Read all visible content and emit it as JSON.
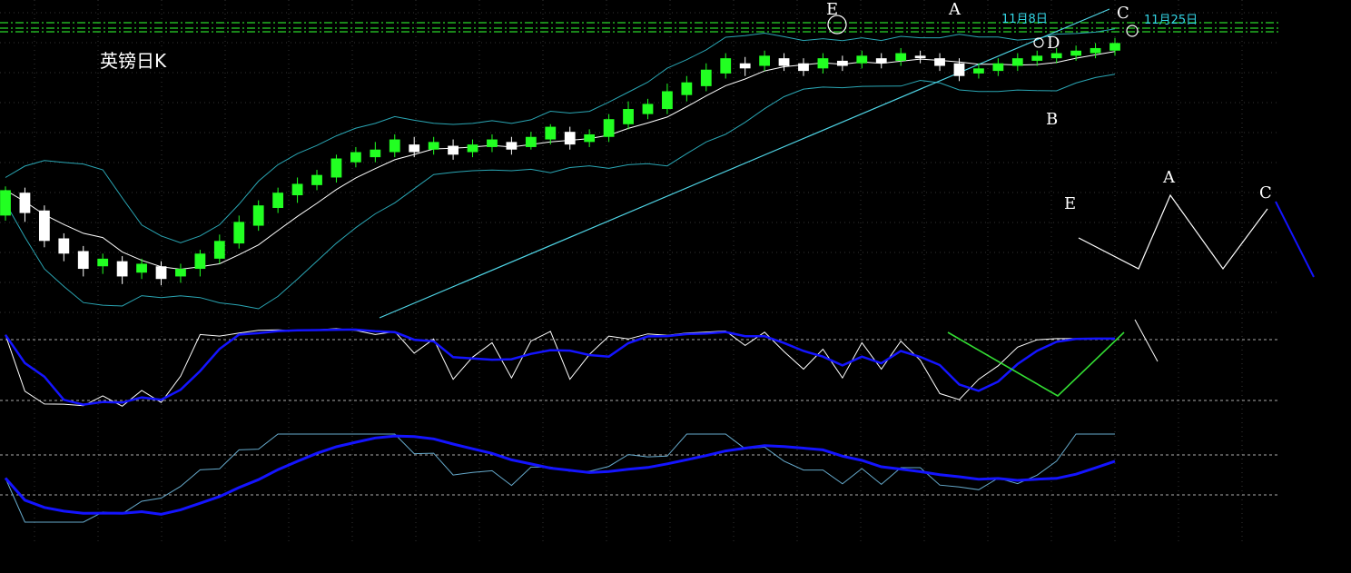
{
  "title": "英镑日K",
  "colors": {
    "background": "#000000",
    "up_candle": "#22ff22",
    "down_candle": "#ffffff",
    "bollinger": "#2aa6b4",
    "ma": "#ffffff",
    "trendline": "#4fd5e6",
    "dash_dot": "#2bd62b",
    "kd_fast": "#ffffff",
    "kd_slow": "#1414ff",
    "rsi_fast": "#66aacc",
    "rsi_slow": "#1414ff",
    "green_marker": "#33dd33",
    "projection": "#1414ff",
    "date_text": "#33d6e6"
  },
  "labels": {
    "E": "E",
    "A": "A",
    "B": "B",
    "C": "C",
    "D": "D",
    "date_d": "11月8日",
    "date_c": "11月25日",
    "diagram_E": "E",
    "diagram_A": "A",
    "diagram_C": "C"
  },
  "chart_data": {
    "type": "candlestick",
    "title": "英镑日K",
    "candles": [
      [
        220,
        240,
        216,
        243
      ],
      [
        238,
        222,
        215,
        242
      ],
      [
        224,
        200,
        195,
        228
      ],
      [
        202,
        190,
        184,
        206
      ],
      [
        192,
        178,
        172,
        196
      ],
      [
        180,
        186,
        174,
        190
      ],
      [
        184,
        172,
        166,
        188
      ],
      [
        175,
        182,
        170,
        186
      ],
      [
        180,
        170,
        165,
        184
      ],
      [
        172,
        178,
        167,
        182
      ],
      [
        178,
        190,
        172,
        193
      ],
      [
        186,
        200,
        182,
        205
      ],
      [
        198,
        215,
        194,
        220
      ],
      [
        212,
        228,
        208,
        232
      ],
      [
        226,
        238,
        222,
        242
      ],
      [
        236,
        245,
        230,
        250
      ],
      [
        244,
        252,
        240,
        256
      ],
      [
        250,
        265,
        246,
        268
      ],
      [
        262,
        270,
        258,
        274
      ],
      [
        266,
        272,
        262,
        278
      ],
      [
        270,
        280,
        266,
        284
      ],
      [
        276,
        270,
        266,
        282
      ],
      [
        272,
        278,
        268,
        282
      ],
      [
        275,
        268,
        264,
        280
      ],
      [
        270,
        276,
        266,
        280
      ],
      [
        274,
        280,
        270,
        284
      ],
      [
        278,
        272,
        268,
        282
      ],
      [
        274,
        282,
        272,
        286
      ],
      [
        280,
        290,
        276,
        292
      ],
      [
        286,
        276,
        272,
        290
      ],
      [
        278,
        284,
        274,
        288
      ],
      [
        282,
        296,
        278,
        300
      ],
      [
        292,
        304,
        288,
        310
      ],
      [
        300,
        308,
        296,
        312
      ],
      [
        304,
        318,
        300,
        324
      ],
      [
        315,
        325,
        310,
        330
      ],
      [
        322,
        335,
        318,
        340
      ],
      [
        332,
        344,
        328,
        348
      ],
      [
        340,
        336,
        330,
        345
      ],
      [
        338,
        346,
        334,
        350
      ],
      [
        344,
        338,
        334,
        348
      ],
      [
        340,
        334,
        330,
        344
      ],
      [
        336,
        344,
        332,
        348
      ],
      [
        342,
        338,
        334,
        346
      ],
      [
        340,
        346,
        336,
        350
      ],
      [
        344,
        340,
        336,
        348
      ],
      [
        342,
        348,
        338,
        352
      ],
      [
        346,
        344,
        340,
        350
      ],
      [
        344,
        338,
        334,
        348
      ],
      [
        340,
        330,
        326,
        344
      ],
      [
        332,
        336,
        328,
        340
      ],
      [
        334,
        340,
        330,
        344
      ],
      [
        338,
        344,
        334,
        348
      ],
      [
        342,
        346,
        338,
        350
      ],
      [
        344,
        348,
        340,
        352
      ],
      [
        346,
        350,
        342,
        354
      ],
      [
        348,
        352,
        344,
        356
      ],
      [
        350,
        356,
        346,
        360
      ]
    ],
    "points": [
      {
        "label": "E",
        "date": ""
      },
      {
        "label": "A",
        "date": ""
      },
      {
        "label": "B",
        "date": ""
      },
      {
        "label": "C",
        "date": "11月25日"
      },
      {
        "label": "D",
        "date": "11月8日"
      }
    ],
    "diagram": [
      "E",
      "A",
      "C"
    ]
  }
}
